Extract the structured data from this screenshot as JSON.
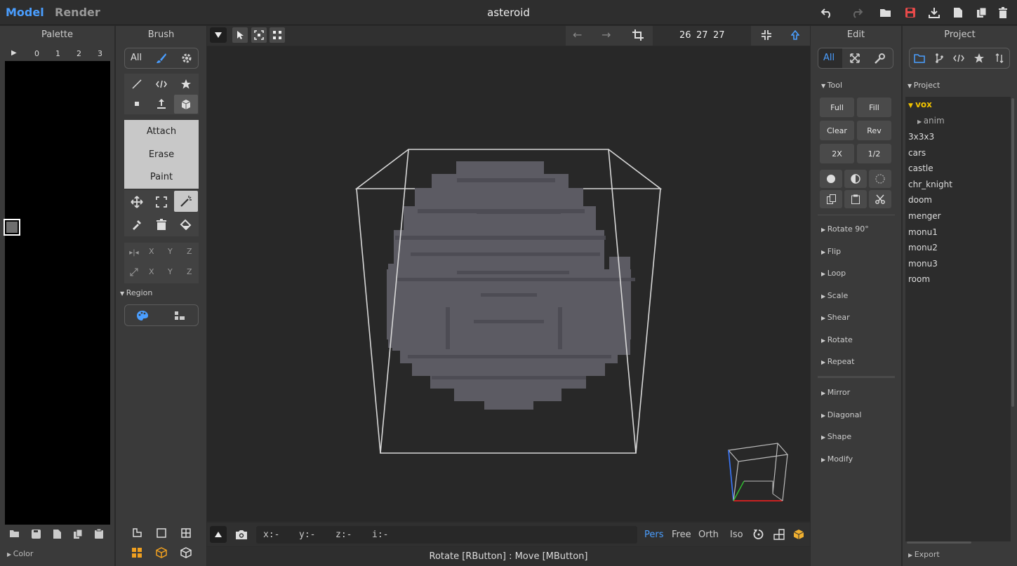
{
  "app": {
    "title": "asteroid",
    "mode_model": "Model",
    "mode_render": "Render"
  },
  "colors": {
    "accent": "#4a9eff",
    "selected": "#f0c200",
    "save": "#e84a4a",
    "voxel": "#5c5b63",
    "bg": "#2b2b2b"
  },
  "palette": {
    "title": "Palette",
    "tabs": [
      "0",
      "1",
      "2",
      "3"
    ],
    "color_section": "Color"
  },
  "brush": {
    "title": "Brush",
    "tab_all": "All",
    "modes": [
      "Attach",
      "Erase",
      "Paint"
    ],
    "mirror_labels": [
      "X",
      "Y",
      "Z"
    ],
    "region": "Region"
  },
  "viewport": {
    "size": {
      "x": "26",
      "y": "27",
      "z": "27"
    },
    "coords": {
      "x": "x:-",
      "y": "y:-",
      "z": "z:-",
      "i": "i:-"
    },
    "views": [
      "Pers",
      "Free",
      "Orth",
      "Iso"
    ],
    "status": "Rotate [RButton] : Move [MButton]"
  },
  "edit": {
    "title": "Edit",
    "tab_all": "All",
    "tool_section": "Tool",
    "tool_buttons": [
      "Full",
      "Fill",
      "Clear",
      "Rev",
      "2X",
      "1/2"
    ],
    "sections_a": [
      "Rotate 90°",
      "Flip",
      "Loop",
      "Scale",
      "Shear",
      "Rotate",
      "Repeat"
    ],
    "sections_b": [
      "Mirror",
      "Diagonal",
      "Shape",
      "Modify"
    ]
  },
  "project": {
    "title": "Project",
    "section": "Project",
    "folder": "vox",
    "subfolder": "anim",
    "items": [
      "3x3x3",
      "cars",
      "castle",
      "chr_knight",
      "doom",
      "menger",
      "monu1",
      "monu2",
      "monu3",
      "room"
    ],
    "export": "Export"
  }
}
